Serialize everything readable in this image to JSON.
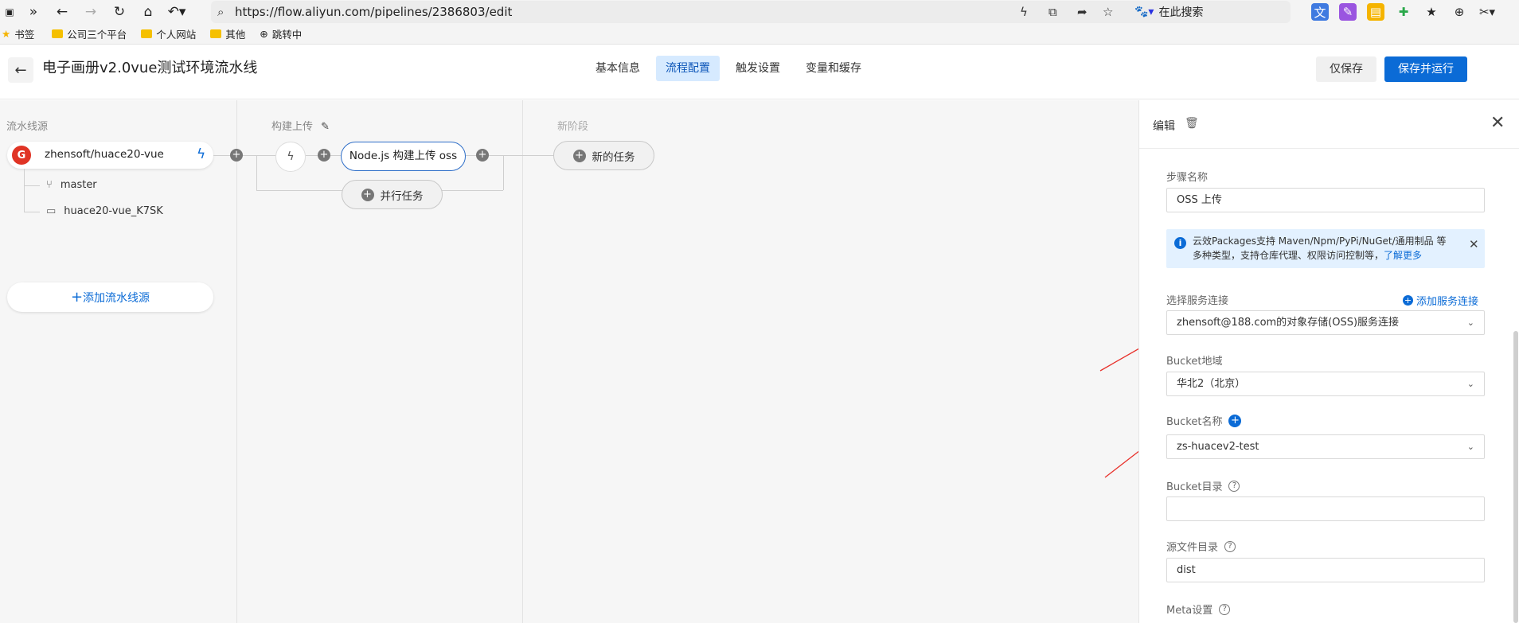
{
  "browser": {
    "url": "https://flow.aliyun.com/pipelines/2386803/edit",
    "search_placeholder": "在此搜索"
  },
  "bookmarks": {
    "items": [
      "书签",
      "公司三个平台",
      "个人网站",
      "其他",
      "跳转中"
    ]
  },
  "header": {
    "title": "电子画册v2.0vue测试环境流水线",
    "tabs": [
      "基本信息",
      "流程配置",
      "触发设置",
      "变量和缓存"
    ],
    "active_tab": "流程配置",
    "save_label": "仅保存",
    "save_run_label": "保存并运行"
  },
  "canvas": {
    "col_source_title": "流水线源",
    "col_build_title": "构建上传",
    "col_new_title": "新阶段",
    "source": {
      "repo": "zhensoft/huace20-vue",
      "logo_letter": "G",
      "branch": "master",
      "folder": "huace20-vue_K7SK"
    },
    "add_source_label": "添加流水线源",
    "task_node_label": "Node.js 构建上传 oss",
    "parallel_task_label": "并行任务",
    "new_task_label": "新的任务"
  },
  "panel": {
    "title": "编辑",
    "step_name_label": "步骤名称",
    "step_name_value": "OSS 上传",
    "info_text": "云效Packages支持 Maven/Npm/PyPi/NuGet/通用制品 等多种类型，支持仓库代理、权限访问控制等，",
    "info_link": "了解更多",
    "service_label": "选择服务连接",
    "add_service_label": "添加服务连接",
    "service_value": "zhensoft@188.com的对象存储(OSS)服务连接",
    "bucket_region_label": "Bucket地域",
    "bucket_region_value": "华北2（北京）",
    "bucket_name_label": "Bucket名称",
    "bucket_name_value": "zs-huacev2-test",
    "bucket_dir_label": "Bucket目录",
    "bucket_dir_value": "",
    "source_dir_label": "源文件目录",
    "source_dir_value": "dist",
    "meta_label": "Meta设置"
  },
  "colors": {
    "accent": "#0b6bd6",
    "tab_active_bg": "#d6eaff",
    "annotation": "#e8302a"
  }
}
